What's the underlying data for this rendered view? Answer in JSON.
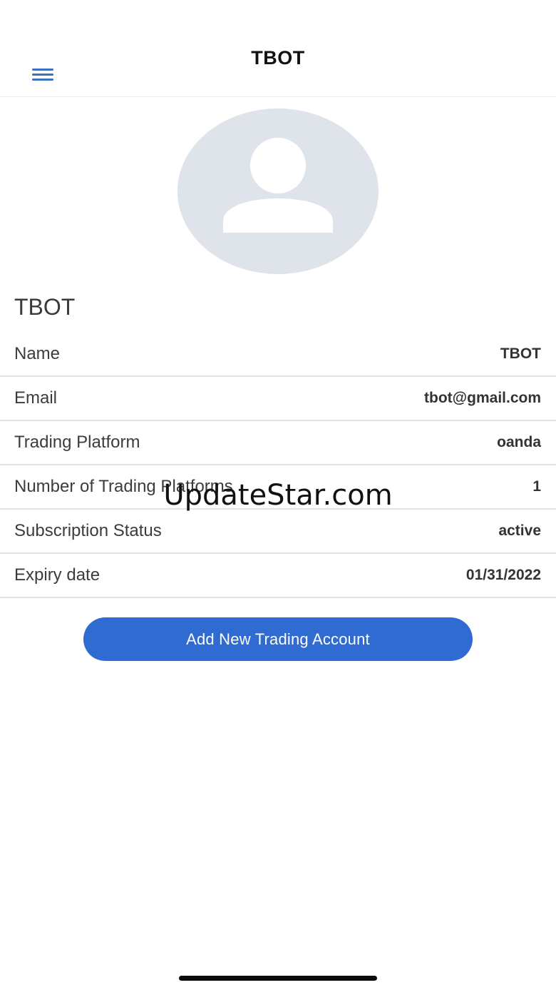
{
  "header": {
    "title": "TBOT",
    "menu_icon": "hamburger-menu-icon"
  },
  "profile": {
    "avatar_icon": "user-avatar-placeholder-icon",
    "name": "TBOT"
  },
  "details": [
    {
      "label": "Name",
      "value": "TBOT"
    },
    {
      "label": "Email",
      "value": "tbot@gmail.com"
    },
    {
      "label": "Trading Platform",
      "value": "oanda"
    },
    {
      "label": "Number of Trading Platforms",
      "value": "1"
    },
    {
      "label": "Subscription Status",
      "value": "active"
    },
    {
      "label": "Expiry date",
      "value": "01/31/2022"
    }
  ],
  "actions": {
    "add_account_label": "Add New Trading Account"
  },
  "watermark": "UpdateStar.com",
  "colors": {
    "accent": "#2f6bd0",
    "menu_icon": "#3d6fc4",
    "avatar_bg": "#dfe3ea",
    "divider": "#e3e3e3"
  }
}
